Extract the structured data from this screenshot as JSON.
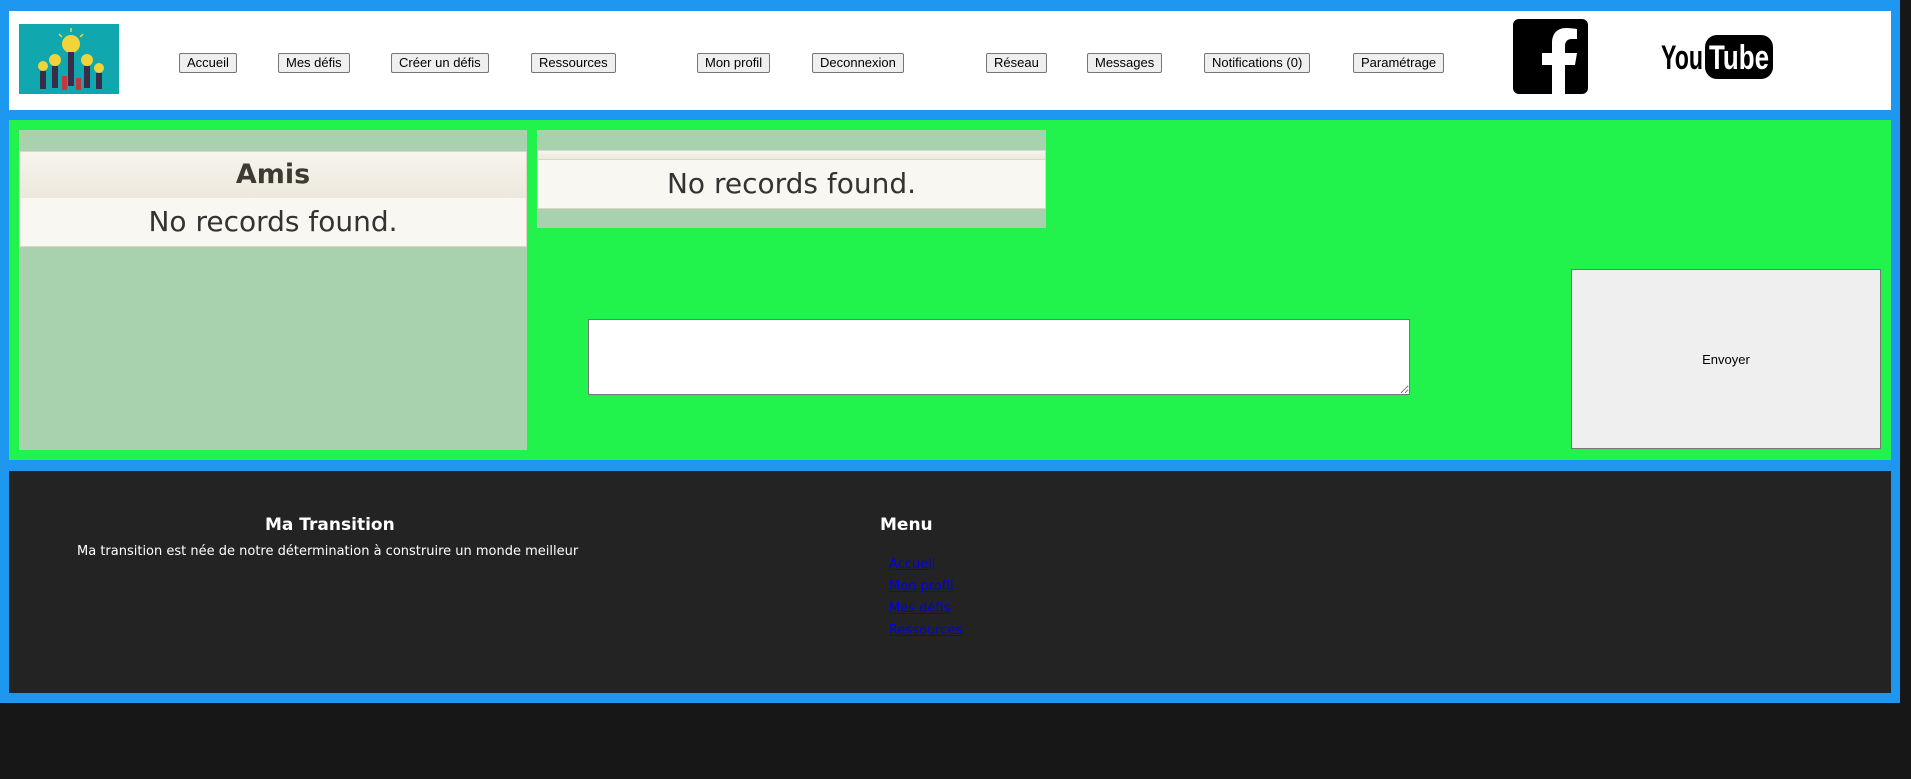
{
  "nav": {
    "items": [
      {
        "label": "Accueil"
      },
      {
        "label": "Mes défis"
      },
      {
        "label": "Créer un défis"
      },
      {
        "label": "Ressources"
      },
      {
        "label": "Mon profil"
      },
      {
        "label": "Deconnexion"
      },
      {
        "label": "Réseau"
      },
      {
        "label": "Messages"
      },
      {
        "label": "Notifications (0)"
      },
      {
        "label": "Paramétrage"
      }
    ],
    "logo_icon": "lightbulb-ideas-logo",
    "social": {
      "facebook_icon": "facebook-icon",
      "youtube_icon": "youtube-logo"
    }
  },
  "friends": {
    "title": "Amis",
    "empty_message": "No records found."
  },
  "messages": {
    "empty_message": "No records found.",
    "input_value": "",
    "send_label": "Envoyer"
  },
  "footer": {
    "about_title": "Ma Transition",
    "about_text": "Ma transition est née de notre détermination à construire un monde meilleur",
    "menu_title": "Menu",
    "menu_links": [
      {
        "label": "Accueil"
      },
      {
        "label": "Mon profil"
      },
      {
        "label": "Mes défis"
      },
      {
        "label": "Ressources"
      }
    ]
  },
  "colors": {
    "frame": "#1e97f0",
    "main_bg": "#22f24c",
    "panel_bg": "#a8d1ae",
    "footer_bg": "#232323",
    "page_bg": "#171717"
  }
}
